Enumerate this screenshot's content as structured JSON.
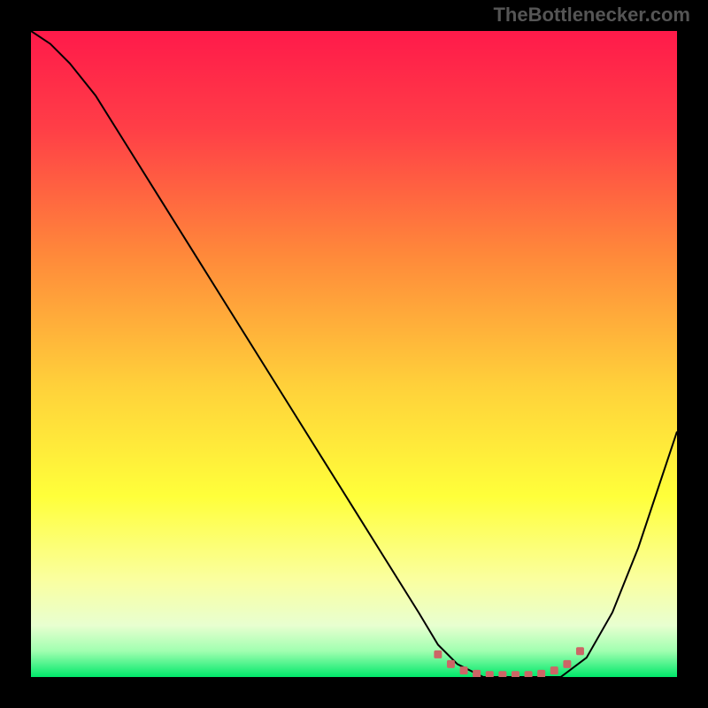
{
  "watermark": "TheBottlenecker.com",
  "chart_data": {
    "type": "line",
    "title": "",
    "xlabel": "",
    "ylabel": "",
    "xlim": [
      0,
      100
    ],
    "ylim": [
      0,
      100
    ],
    "background_gradient": {
      "stops": [
        {
          "pos": 0.0,
          "color": "#ff1a4a"
        },
        {
          "pos": 0.15,
          "color": "#ff3e47"
        },
        {
          "pos": 0.35,
          "color": "#ff8a3a"
        },
        {
          "pos": 0.55,
          "color": "#ffd13a"
        },
        {
          "pos": 0.72,
          "color": "#ffff3a"
        },
        {
          "pos": 0.85,
          "color": "#faffa0"
        },
        {
          "pos": 0.92,
          "color": "#e8ffd0"
        },
        {
          "pos": 0.96,
          "color": "#a0ffb0"
        },
        {
          "pos": 1.0,
          "color": "#00e86a"
        }
      ]
    },
    "series": [
      {
        "name": "bottleneck-curve",
        "color": "#000000",
        "width": 2,
        "x": [
          0,
          3,
          6,
          10,
          15,
          20,
          25,
          30,
          35,
          40,
          45,
          50,
          55,
          60,
          63,
          66,
          70,
          74,
          78,
          82,
          86,
          90,
          94,
          100
        ],
        "y": [
          100,
          98,
          95,
          90,
          82,
          74,
          66,
          58,
          50,
          42,
          34,
          26,
          18,
          10,
          5,
          2,
          0,
          0,
          0,
          0,
          3,
          10,
          20,
          38
        ]
      }
    ],
    "markers": {
      "name": "optimal-range",
      "color": "#cc6666",
      "size": 9,
      "x": [
        63,
        65,
        67,
        69,
        71,
        73,
        75,
        77,
        79,
        81,
        83,
        85
      ],
      "y": [
        3.5,
        2.0,
        1.0,
        0.5,
        0.3,
        0.3,
        0.3,
        0.3,
        0.5,
        1.0,
        2.0,
        4.0
      ]
    }
  }
}
